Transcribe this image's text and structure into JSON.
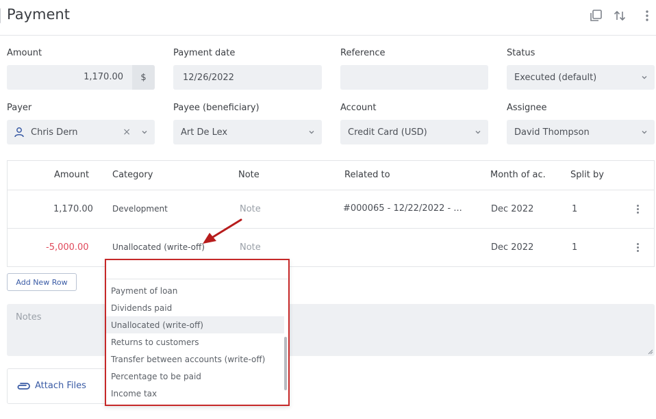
{
  "header": {
    "title": "Payment"
  },
  "icons": {
    "copy": "copy-icon",
    "sort": "sort-icon",
    "more": "more-vertical-icon",
    "user": "user-icon",
    "clip": "paperclip-icon"
  },
  "form": {
    "amount": {
      "label": "Amount",
      "value": "1,170.00",
      "currency": "$"
    },
    "payment_date": {
      "label": "Payment date",
      "value": "12/26/2022"
    },
    "reference": {
      "label": "Reference",
      "value": ""
    },
    "status": {
      "label": "Status",
      "value": "Executed (default)"
    },
    "payer": {
      "label": "Payer",
      "value": "Chris Dern",
      "clear": "×"
    },
    "payee": {
      "label": "Payee (beneficiary)",
      "value": "Art De Lex"
    },
    "account": {
      "label": "Account",
      "value": "Credit Card (USD)"
    },
    "assignee": {
      "label": "Assignee",
      "value": "David Thompson"
    }
  },
  "table": {
    "headers": {
      "amount": "Amount",
      "category": "Category",
      "note": "Note",
      "related": "Related to",
      "month": "Month of ac.",
      "split": "Split by"
    },
    "rows": [
      {
        "amount": "1,170.00",
        "category": "Development",
        "note": "Note",
        "related": "#000065 - 12/22/2022 - ...",
        "month": "Dec 2022",
        "split": "1"
      },
      {
        "amount": "-5,000.00",
        "category": "Unallocated (write-off)",
        "note": "Note",
        "related": "",
        "month": "Dec 2022",
        "split": "1"
      }
    ]
  },
  "add_row_label": "Add New Row",
  "notes": {
    "placeholder": "Notes"
  },
  "attach_label": "Attach Files",
  "category_dropdown": {
    "options": [
      "Payment of loan",
      "Dividends paid",
      "Unallocated (write-off)",
      "Returns to customers",
      "Transfer between accounts (write-off)",
      "Percentage to be paid",
      "Income tax"
    ],
    "selected": "Unallocated (write-off)"
  },
  "colors": {
    "accent": "#3a5ba5",
    "negative": "#e0485a",
    "highlight_border": "#c62828",
    "arrow": "#b71c1c"
  }
}
